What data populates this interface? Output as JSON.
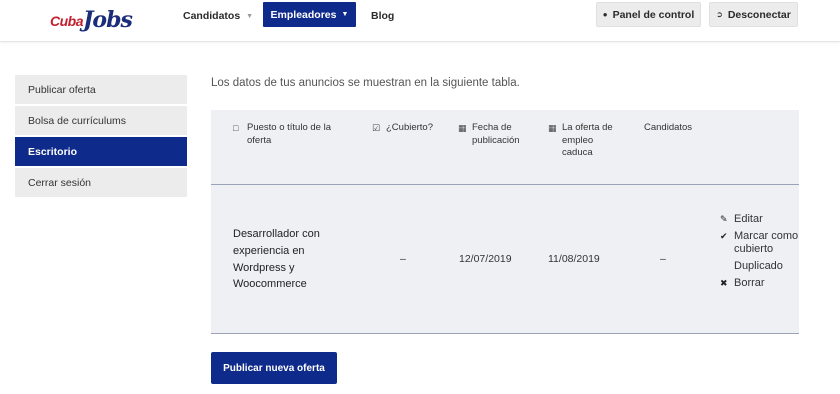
{
  "header": {
    "logo": {
      "part1": "Cuba",
      "part2": "Jobs"
    },
    "nav": {
      "candidatos": "Candidatos",
      "empleadores": "Empleadores",
      "blog": "Blog"
    },
    "panel_button": "Panel de control",
    "logout_button": "Desconectar"
  },
  "sidebar": {
    "items": [
      {
        "label": "Publicar oferta"
      },
      {
        "label": "Bolsa de currículums"
      },
      {
        "label": "Escritorio"
      },
      {
        "label": "Cerrar sesión"
      }
    ]
  },
  "main": {
    "intro": "Los datos de tus anuncios se muestran en la siguiente tabla.",
    "table": {
      "headers": {
        "title": "Puesto o título de la oferta",
        "covered": "¿Cubierto?",
        "published": "Fecha de publicación",
        "expires": "La oferta de empleo caduca",
        "candidates": "Candidatos"
      },
      "row": {
        "title": "Desarrollador con experiencia en Wordpress y Woocommerce",
        "covered": "–",
        "published": "12/07/2019",
        "expires": "11/08/2019",
        "candidates": "–"
      },
      "actions": {
        "edit": "Editar",
        "mark": "Marcar como cubierto",
        "duplicate": "Duplicado",
        "delete": "Borrar"
      }
    },
    "publish_button": "Publicar nueva oferta"
  },
  "colors": {
    "brand_blue": "#0e2a8a",
    "brand_red": "#c21f2f",
    "table_bg": "#eff0f4"
  }
}
